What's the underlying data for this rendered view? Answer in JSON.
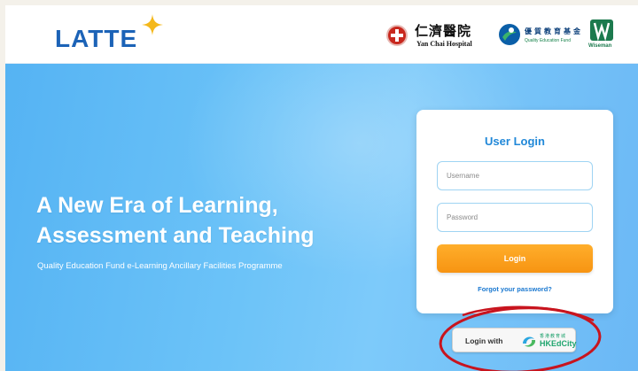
{
  "header": {
    "logo_text": "LATTE",
    "partners": {
      "yanchai_cn": "仁濟醫院",
      "yanchai_en": "Yan Chai Hospital",
      "qef_cn": "優質教育基金",
      "qef_en": "Quality Education Fund",
      "wiseman": "Wiseman"
    }
  },
  "hero": {
    "headline_line1": "A New Era of Learning,",
    "headline_line2": "Assessment and Teaching",
    "subline": "Quality Education Fund e-Learning Ancillary Facilities Programme"
  },
  "login": {
    "title": "User Login",
    "username_placeholder": "Username",
    "password_placeholder": "Password",
    "login_label": "Login",
    "forgot_label": "Forgot your password?"
  },
  "edcity": {
    "label": "Login with",
    "logo_cn": "香港教育城",
    "logo_en": "HKEdCity"
  },
  "colors": {
    "brand_blue": "#1c63b7",
    "accent_orange": "#f79412",
    "hero_blue": "#6cc3f8",
    "annotation_red": "#c8141e"
  }
}
